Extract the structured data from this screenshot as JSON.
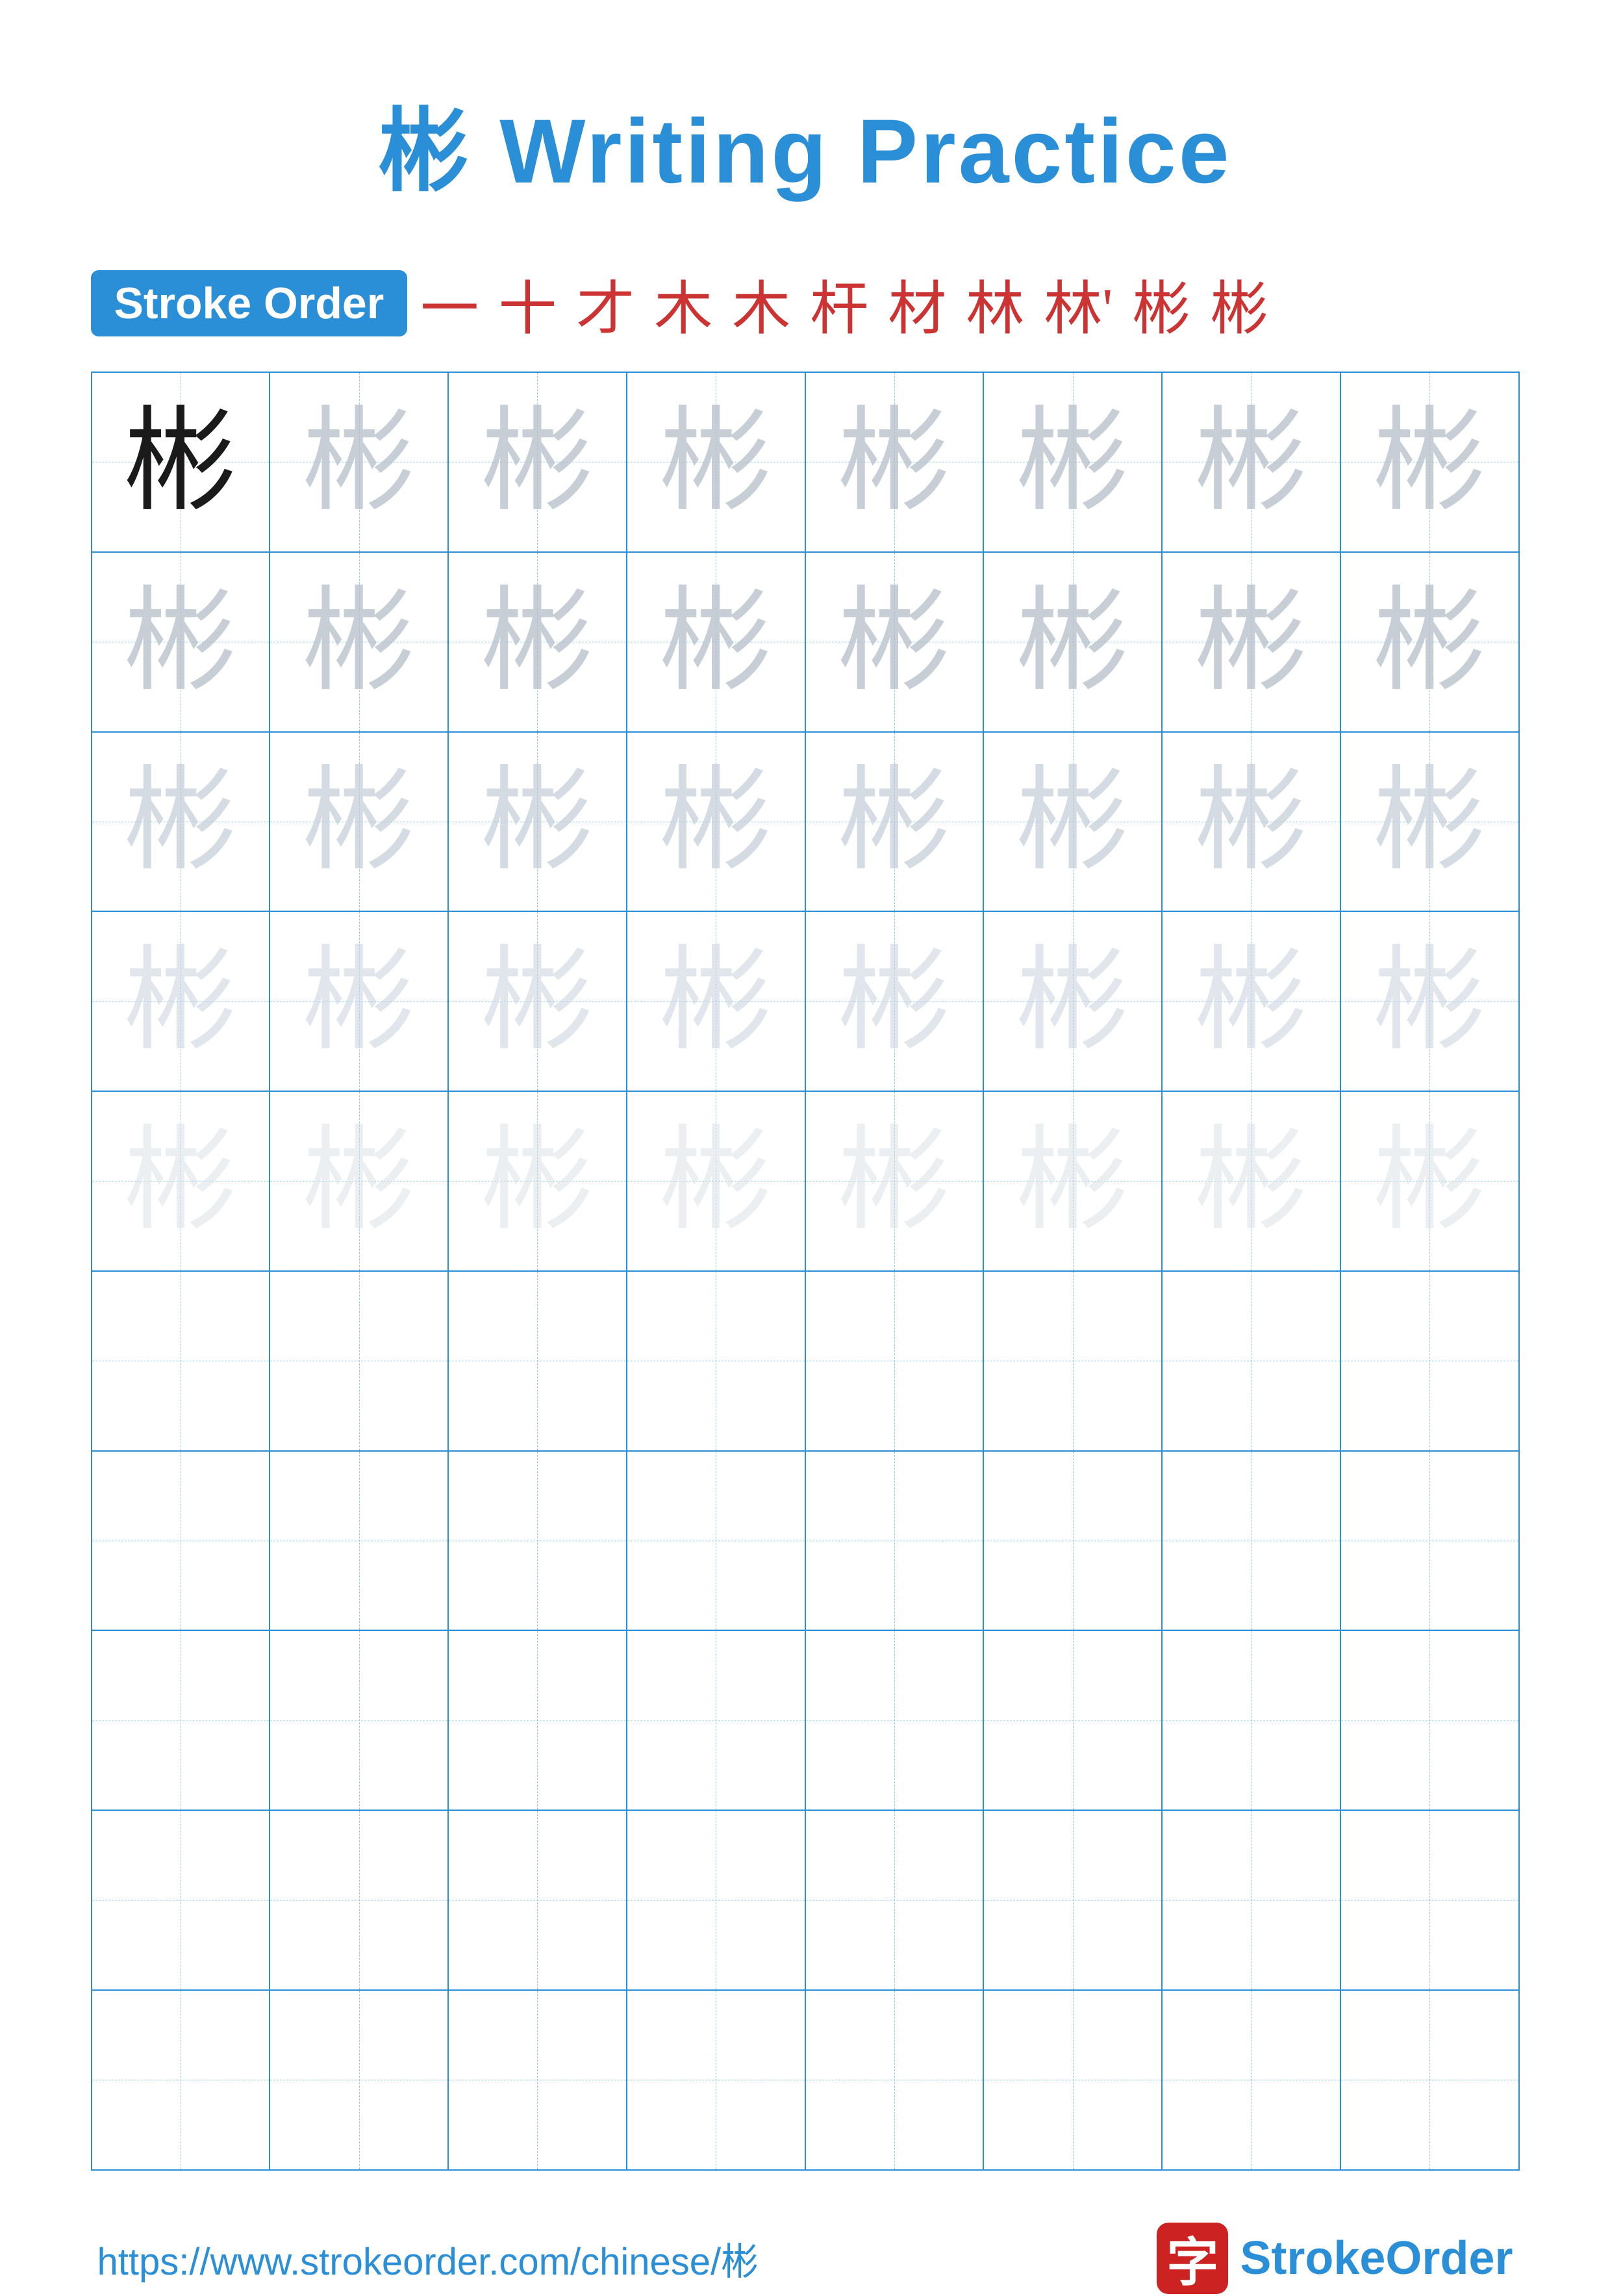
{
  "title": {
    "kanji": "彬",
    "text": "Writing Practice"
  },
  "stroke_order": {
    "badge_label": "Stroke Order",
    "strokes": [
      "一",
      "十",
      "才",
      "木",
      "木",
      "杆",
      "材",
      "林",
      "林'",
      "彬",
      "彬"
    ]
  },
  "grid": {
    "rows": 10,
    "cols": 8,
    "character": "彬",
    "row_types": [
      "solid-then-ghost1",
      "ghost1",
      "ghost2",
      "ghost3",
      "ghost4",
      "empty",
      "empty",
      "empty",
      "empty",
      "empty"
    ]
  },
  "footer": {
    "url": "https://www.strokeorder.com/chinese/彬",
    "brand_text_part1": "Stroke",
    "brand_text_part2": "Order",
    "logo_char": "字"
  }
}
